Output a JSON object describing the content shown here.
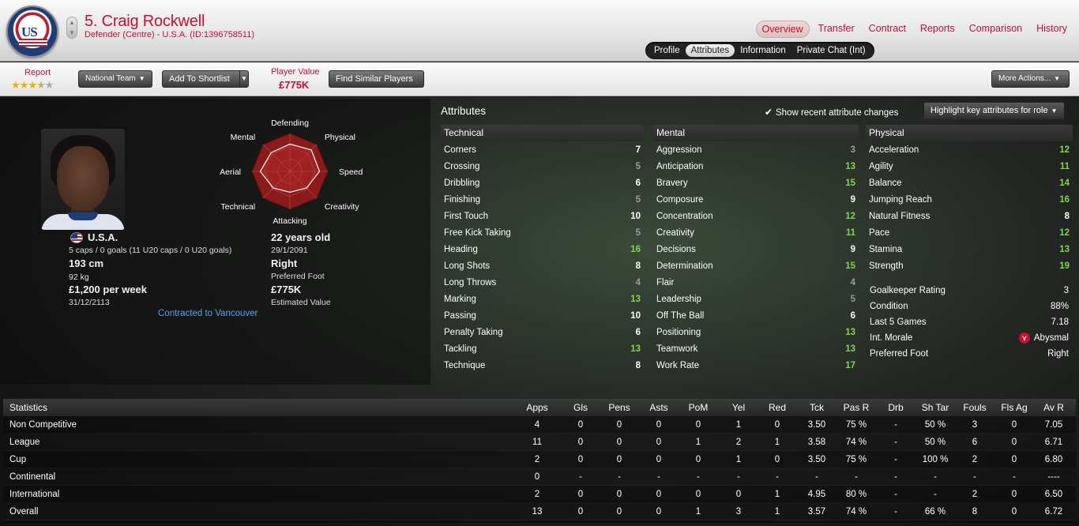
{
  "header": {
    "player_name": "5. Craig Rockwell",
    "player_sub": "Defender (Centre) - U.S.A. (ID:1396758511)",
    "crest_text": "US",
    "nav": [
      "Overview",
      "Transfer",
      "Contract",
      "Reports",
      "Comparison",
      "History"
    ],
    "nav_active": "Overview",
    "subnav": [
      "Profile",
      "Attributes",
      "Information",
      "Private Chat (Int)"
    ],
    "subnav_active": "Attributes"
  },
  "toolbar": {
    "report_label": "Report",
    "report_stars": 3.5,
    "national_team": "National Team",
    "add_shortlist": "Add To Shortlist",
    "player_value_label": "Player Value",
    "player_value": "£775K",
    "find_similar": "Find Similar Players",
    "more_actions": "More Actions..."
  },
  "radar": {
    "labels": [
      "Defending",
      "Physical",
      "Speed",
      "Creativity",
      "Attacking",
      "Technical",
      "Aerial",
      "Mental"
    ],
    "values": [
      0.72,
      0.8,
      0.78,
      0.62,
      0.55,
      0.62,
      0.78,
      0.7
    ],
    "colors": {
      "fill": "#8b1a1a",
      "shape": "#c83232",
      "grid": "#b45050"
    }
  },
  "info": {
    "nationality": "U.S.A.",
    "caps": "5 caps / 0 goals (11 U20 caps / 0 U20 goals)",
    "height": "193 cm",
    "weight": "92 kg",
    "wage": "£1,200 per week",
    "contract_end": "31/12/2113",
    "age": "22 years old",
    "dob": "29/1/2091",
    "foot": "Right",
    "foot_label": "Preferred Foot",
    "est_value": "£775K",
    "est_value_label": "Estimated Value",
    "contracted": "Contracted to Vancouver"
  },
  "attributes": {
    "title": "Attributes",
    "recent_changes": "Show recent attribute changes",
    "highlight": "Highlight key attributes for role",
    "technical": {
      "head": "Technical",
      "items": [
        [
          "Corners",
          7
        ],
        [
          "Crossing",
          5
        ],
        [
          "Dribbling",
          6
        ],
        [
          "Finishing",
          5
        ],
        [
          "First Touch",
          10
        ],
        [
          "Free Kick Taking",
          5
        ],
        [
          "Heading",
          16
        ],
        [
          "Long Shots",
          8
        ],
        [
          "Long Throws",
          4
        ],
        [
          "Marking",
          13
        ],
        [
          "Passing",
          10
        ],
        [
          "Penalty Taking",
          6
        ],
        [
          "Tackling",
          13
        ],
        [
          "Technique",
          8
        ]
      ]
    },
    "mental": {
      "head": "Mental",
      "items": [
        [
          "Aggression",
          3
        ],
        [
          "Anticipation",
          13
        ],
        [
          "Bravery",
          15
        ],
        [
          "Composure",
          9
        ],
        [
          "Concentration",
          12
        ],
        [
          "Creativity",
          11
        ],
        [
          "Decisions",
          9
        ],
        [
          "Determination",
          15
        ],
        [
          "Flair",
          4
        ],
        [
          "Leadership",
          5
        ],
        [
          "Off The Ball",
          6
        ],
        [
          "Positioning",
          13
        ],
        [
          "Teamwork",
          13
        ],
        [
          "Work Rate",
          17
        ]
      ]
    },
    "physical": {
      "head": "Physical",
      "items": [
        [
          "Acceleration",
          12
        ],
        [
          "Agility",
          11
        ],
        [
          "Balance",
          14
        ],
        [
          "Jumping Reach",
          16
        ],
        [
          "Natural Fitness",
          8
        ],
        [
          "Pace",
          12
        ],
        [
          "Stamina",
          13
        ],
        [
          "Strength",
          19
        ]
      ]
    },
    "extra": [
      [
        "Goalkeeper Rating",
        "3"
      ],
      [
        "Condition",
        "88%"
      ],
      [
        "Last 5 Games",
        "7.18"
      ],
      [
        "Int. Morale",
        "Abysmal"
      ],
      [
        "Preferred Foot",
        "Right"
      ]
    ]
  },
  "stats": {
    "headers": [
      "Statistics",
      "Apps",
      "Gls",
      "Pens",
      "Asts",
      "PoM",
      "Yel",
      "Red",
      "Tck",
      "Pas R",
      "Drb",
      "Sh Tar",
      "Fouls",
      "Fls Ag",
      "Av R"
    ],
    "rows": [
      [
        "Non Competitive",
        "4",
        "0",
        "0",
        "0",
        "0",
        "1",
        "0",
        "3.50",
        "75 %",
        "-",
        "50 %",
        "3",
        "0",
        "7.05"
      ],
      [
        "League",
        "11",
        "0",
        "0",
        "0",
        "1",
        "2",
        "1",
        "3.58",
        "74 %",
        "-",
        "50 %",
        "6",
        "0",
        "6.71"
      ],
      [
        "Cup",
        "2",
        "0",
        "0",
        "0",
        "0",
        "1",
        "0",
        "3.50",
        "75 %",
        "-",
        "100 %",
        "2",
        "0",
        "6.80"
      ],
      [
        "Continental",
        "0",
        "-",
        "-",
        "-",
        "-",
        "-",
        "-",
        "-",
        "-",
        "-",
        "-",
        "-",
        "-",
        "----"
      ],
      [
        "International",
        "2",
        "0",
        "0",
        "0",
        "0",
        "0",
        "1",
        "4.95",
        "80 %",
        "-",
        "-",
        "2",
        "0",
        "6.50"
      ],
      [
        "Overall",
        "13",
        "0",
        "0",
        "0",
        "1",
        "3",
        "1",
        "3.57",
        "74 %",
        "-",
        "66 %",
        "8",
        "0",
        "6.72"
      ]
    ]
  }
}
